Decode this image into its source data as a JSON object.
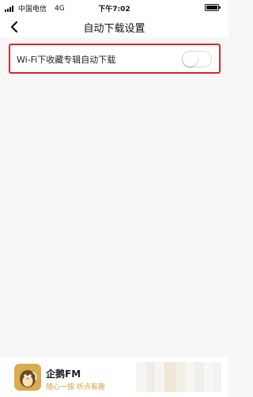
{
  "status_bar": {
    "carrier": "中国电信",
    "network": "4G",
    "time": "下午7:02"
  },
  "nav": {
    "title": "自动下载设置",
    "back_icon": "chevron-left-icon"
  },
  "settings": {
    "wifi_auto_download": {
      "label": "Wi-Fi下收藏专辑自动下载",
      "enabled": false
    }
  },
  "footer": {
    "app_name": "企鹅FM",
    "slogan": "随心一按 听点有趣"
  },
  "colors": {
    "highlight_border": "#d9262b",
    "background": "#f7f7f7",
    "slogan": "#d4a33a",
    "logo": "#d9ab4f"
  }
}
